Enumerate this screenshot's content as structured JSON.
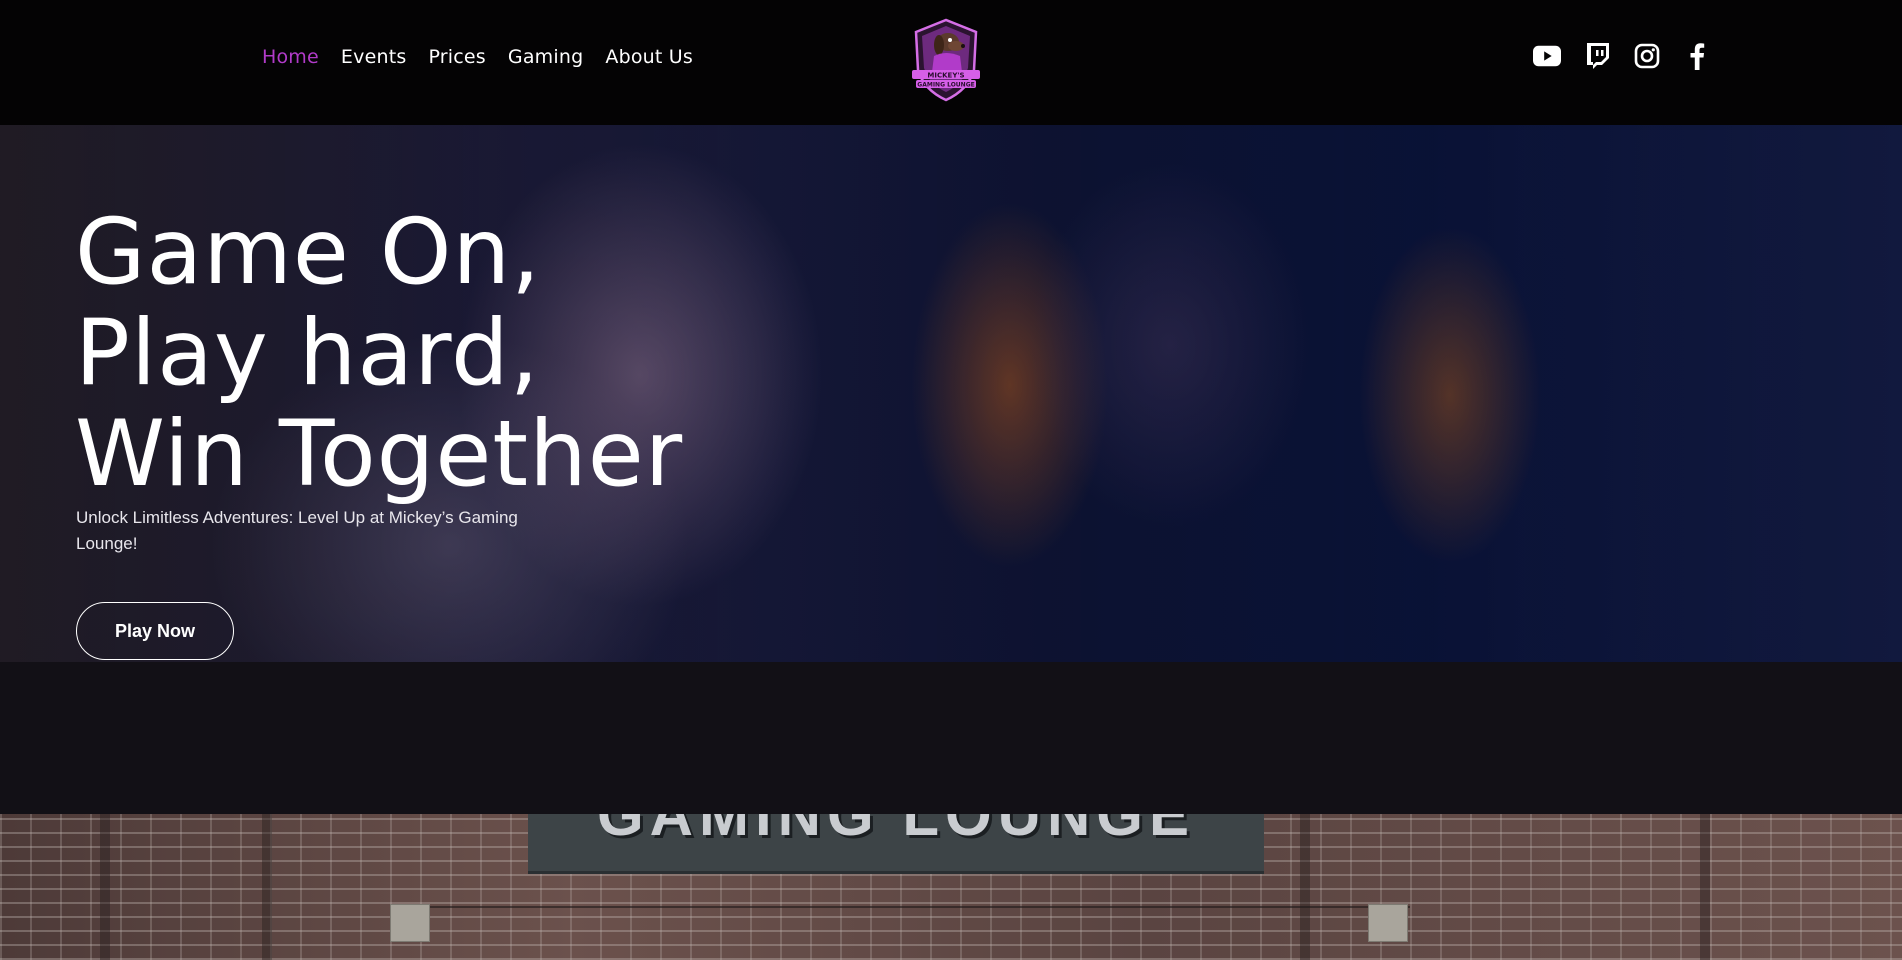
{
  "nav": {
    "items": [
      {
        "label": "Home",
        "active": true
      },
      {
        "label": "Events",
        "active": false
      },
      {
        "label": "Prices",
        "active": false
      },
      {
        "label": "Gaming",
        "active": false
      },
      {
        "label": "About Us",
        "active": false
      }
    ]
  },
  "logo": {
    "text_line1": "MICKEY'S",
    "text_line2": "GAMING LOUNGE"
  },
  "social": {
    "icons": [
      "youtube-icon",
      "twitch-icon",
      "instagram-icon",
      "facebook-icon"
    ]
  },
  "hero": {
    "title_lines": [
      "Game On,",
      "Play hard,",
      "Win Together"
    ],
    "subtitle": "Unlock Limitless Adventures: Level Up at Mickey’s Gaming Lounge!",
    "cta_label": "Play Now"
  },
  "building": {
    "sign_text": "GAMING LOUNGE"
  },
  "colors": {
    "accent": "#b13bc9",
    "header_bg": "#040304",
    "band_bg": "#121016",
    "text": "#ffffff"
  }
}
